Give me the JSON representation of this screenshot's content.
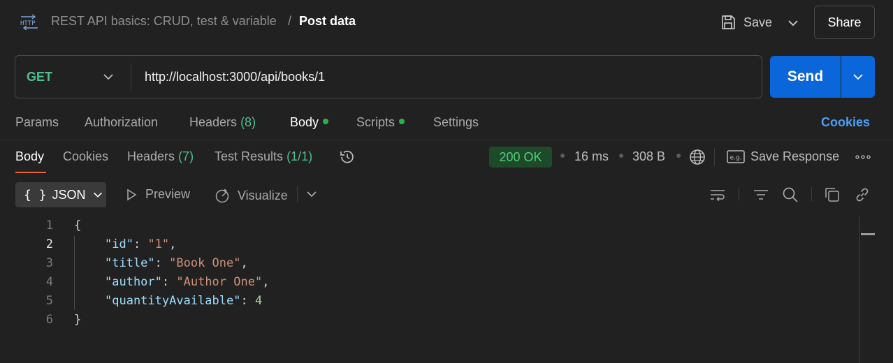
{
  "header": {
    "breadcrumb_parent": "REST API basics: CRUD, test & variable",
    "breadcrumb_separator": "/",
    "breadcrumb_current": "Post data",
    "save_label": "Save",
    "share_label": "Share",
    "http_icon": "http-icon"
  },
  "request": {
    "method": "GET",
    "url": "http://localhost:3000/api/books/1",
    "send_label": "Send",
    "method_color": "#4fc08d",
    "send_color": "#0b66d9"
  },
  "request_tabs": [
    {
      "label": "Params",
      "count": ""
    },
    {
      "label": "Authorization",
      "count": ""
    },
    {
      "label": "Headers",
      "count": "(8)"
    },
    {
      "label": "Body",
      "count": ""
    },
    {
      "label": "Scripts",
      "count": ""
    },
    {
      "label": "Settings",
      "count": ""
    }
  ],
  "cookies_link": "Cookies",
  "response_tabs": [
    {
      "label": "Body",
      "count": ""
    },
    {
      "label": "Cookies",
      "count": ""
    },
    {
      "label": "Headers",
      "count": "(7)"
    },
    {
      "label": "Test Results",
      "count": "(1/1)"
    }
  ],
  "response_meta": {
    "status": "200 OK",
    "time": "16 ms",
    "size": "308 B",
    "save_response_label": "Save Response",
    "status_color": "#4fd17c"
  },
  "format_toolbar": {
    "format_braces": "{ }",
    "format_label": "JSON",
    "preview_label": "Preview",
    "visualize_label": "Visualize"
  },
  "code": {
    "line_numbers": [
      "1",
      "2",
      "3",
      "4",
      "5",
      "6"
    ],
    "open_brace": "{",
    "close_brace": "}",
    "fields": [
      {
        "key": "\"id\"",
        "value": "\"1\"",
        "type": "string",
        "trailing": ","
      },
      {
        "key": "\"title\"",
        "value": "\"Book One\"",
        "type": "string",
        "trailing": ","
      },
      {
        "key": "\"author\"",
        "value": "\"Author One\"",
        "type": "string",
        "trailing": ","
      },
      {
        "key": "\"quantityAvailable\"",
        "value": "4",
        "type": "number",
        "trailing": ""
      }
    ]
  }
}
